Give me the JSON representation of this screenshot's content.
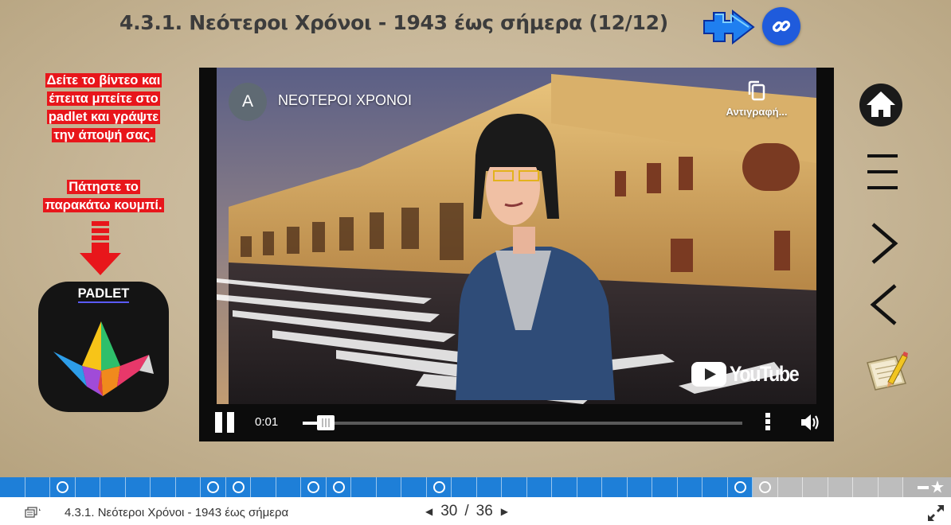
{
  "slide": {
    "title": "4.3.1. Νεότεροι Χρόνοι - 1943 έως σήμερα (12/12)",
    "instructions_1": [
      "Δείτε το βίντεο και",
      "έπειτα μπείτε στο",
      "padlet και γράψτε",
      "την άποψή σας."
    ],
    "instructions_2": [
      "Πάτηστε το",
      "παρακάτω κουμπί."
    ],
    "padlet_label": "PADLET",
    "accent_red": "#e8161b",
    "link_blue": "#1f5bdc"
  },
  "video": {
    "channel_initial": "A",
    "title": "ΝΕΟΤΕΡΟΙ ΧΡΟΝΟΙ",
    "copy_label": "Αντιγραφή...",
    "brand": "YouTube",
    "current_time": "0:01",
    "progress_fraction": 0.025,
    "state": "playing"
  },
  "nav": {
    "icons": [
      "home-icon",
      "menu-icon",
      "next-slide-icon",
      "previous-slide-icon",
      "notes-icon"
    ]
  },
  "progress_bar": {
    "total_slides": 36,
    "current_slide": 30,
    "fill_color": "#1e7fd8",
    "marker_slides": [
      3,
      9,
      10,
      13,
      14,
      18,
      30
    ]
  },
  "footer": {
    "title": "4.3.1. Νεότεροι Χρόνοι - 1943 έως σήμερα",
    "current_page": "30",
    "separator": "/",
    "total_pages": "36"
  }
}
